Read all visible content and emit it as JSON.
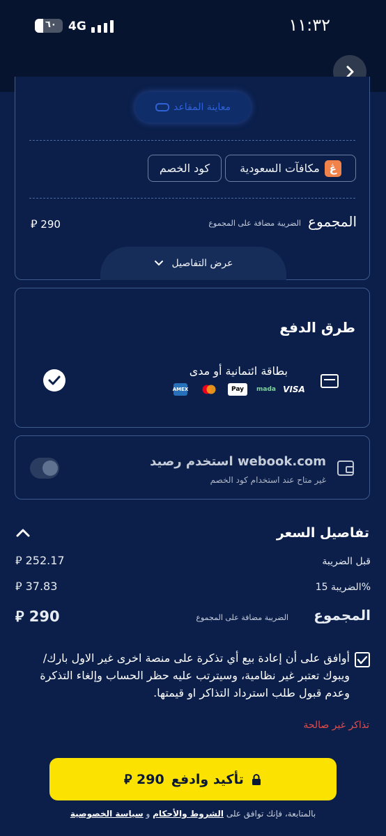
{
  "status_bar": {
    "time": "١١:٣٢",
    "battery": "٦٠",
    "network": "4G"
  },
  "summary": {
    "seat_preview_label": "معاينة المقاعد",
    "promo_code_label": "كود الخصم",
    "rewards_label": "مكافآت السعودية",
    "total_label": "المجموع",
    "tax_note": "الضريبة مضافة على المجموع",
    "total_amount": "290",
    "show_details_label": "عرض التفاصيل"
  },
  "payment": {
    "title": "طرق الدفع",
    "method_label": "بطاقة ائتمانية أو مدى",
    "brands": [
      "VISA",
      "mada",
      "Pay",
      "mastercard",
      "AMEX"
    ]
  },
  "wallet": {
    "title": "استخدم رصيد webook.com",
    "note": "غير متاح عند استخدام كود الخصم"
  },
  "price_details": {
    "title": "تفاصيل السعر",
    "before_tax_label": "قبل الضريبة",
    "before_tax_value": "252.17",
    "tax_label": "الضريبة 15%",
    "tax_value": "37.83",
    "total_label": "المجموع",
    "tax_note": "الضريبة مضافة على المجموع",
    "total_value": "290"
  },
  "agreement": {
    "text": "أوافق على أن إعادة بيع أي تذكرة على منصة اخرى غير الاول بارك/ ويبوك تعتبر غير نظامية، وسيترتب عليه حظر الحساب وإلغاء التذكرة وعدم قبول طلب استرداد التذاكر او قيمتها."
  },
  "invalid_tickets": "تذاكر غير صالحة",
  "confirm_button": {
    "label": "تأكيد وادفع",
    "amount": "290"
  },
  "footer": {
    "prefix": "بالمتابعة، فإنك توافق على",
    "terms": "الشروط والأحكام",
    "and": "و",
    "privacy": "سياسة الخصوصية"
  },
  "currency_symbol": "⃁",
  "colors": {
    "accent": "#fbe200",
    "background": "#0b1f4a",
    "error": "#e04c4c"
  }
}
